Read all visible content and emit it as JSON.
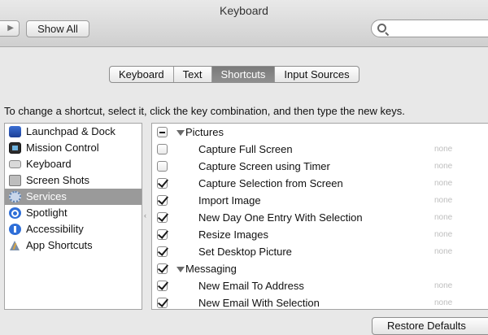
{
  "window": {
    "title": "Keyboard"
  },
  "toolbar": {
    "back_glyph": "▶",
    "show_all_label": "Show All",
    "search_placeholder": "",
    "search_value": ""
  },
  "tabs": [
    {
      "label": "Keyboard",
      "selected": false
    },
    {
      "label": "Text",
      "selected": false
    },
    {
      "label": "Shortcuts",
      "selected": true
    },
    {
      "label": "Input Sources",
      "selected": false
    }
  ],
  "instruction": "To change a shortcut, select it, click the key combination, and then type the new keys.",
  "categories": [
    {
      "label": "Launchpad & Dock",
      "icon": "launchpad-icon"
    },
    {
      "label": "Mission Control",
      "icon": "mission-control-icon"
    },
    {
      "label": "Keyboard",
      "icon": "keyboard-icon"
    },
    {
      "label": "Screen Shots",
      "icon": "screenshot-icon"
    },
    {
      "label": "Services",
      "icon": "services-icon",
      "selected": true
    },
    {
      "label": "Spotlight",
      "icon": "spotlight-icon"
    },
    {
      "label": "Accessibility",
      "icon": "accessibility-icon"
    },
    {
      "label": "App Shortcuts",
      "icon": "app-shortcuts-icon"
    }
  ],
  "services": {
    "group_pictures": "Pictures",
    "group_messaging": "Messaging",
    "items": [
      {
        "label": "Capture Full Screen",
        "checked": false,
        "key": "none"
      },
      {
        "label": "Capture Screen using Timer",
        "checked": false,
        "key": "none"
      },
      {
        "label": "Capture Selection from Screen",
        "checked": true,
        "key": "none"
      },
      {
        "label": "Import Image",
        "checked": true,
        "key": "none"
      },
      {
        "label": "New Day One Entry With Selection",
        "checked": true,
        "key": "none"
      },
      {
        "label": "Resize Images",
        "checked": true,
        "key": "none"
      },
      {
        "label": "Set Desktop Picture",
        "checked": true,
        "key": "none"
      },
      {
        "label": "New Email To Address",
        "checked": true,
        "key": "none"
      },
      {
        "label": "New Email With Selection",
        "checked": true,
        "key": "none"
      }
    ]
  },
  "restore_label": "Restore Defaults",
  "colors": {
    "selection": "#9a9a9a",
    "tab_selected": "#7f7f7f"
  }
}
